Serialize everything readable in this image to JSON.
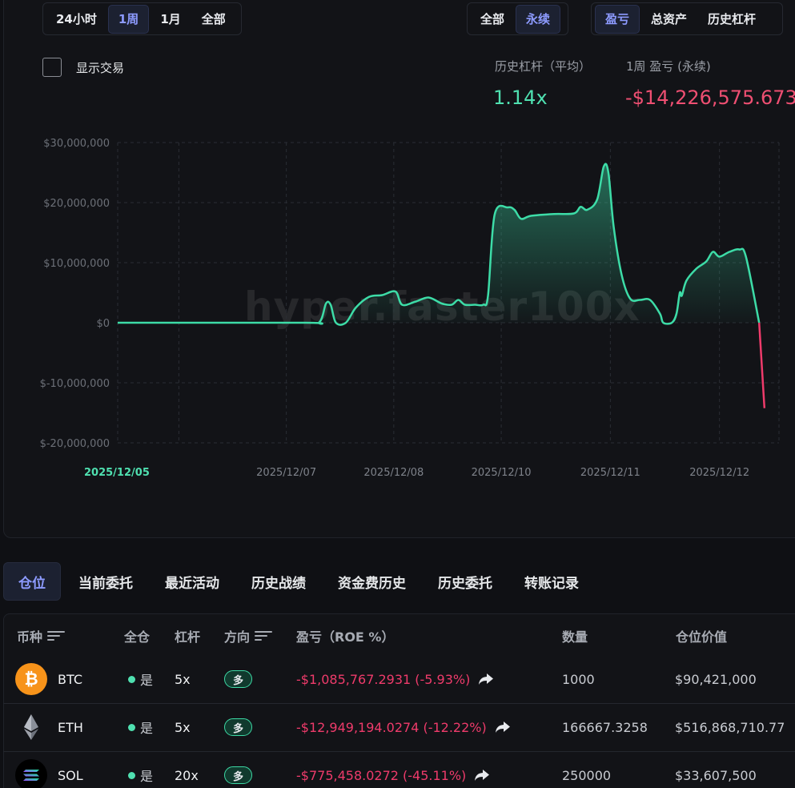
{
  "time_range": {
    "options": [
      "24小时",
      "1周",
      "1月",
      "全部"
    ],
    "selected": "1周"
  },
  "market_filter": {
    "options": [
      "全部",
      "永续"
    ],
    "selected": "永续"
  },
  "metric_tabs": {
    "options": [
      "盈亏",
      "总资产",
      "历史杠杆"
    ],
    "selected": "盈亏"
  },
  "show_trades_label": "显示交易",
  "stats": {
    "leverage_label": "历史杠杆（平均）",
    "leverage_value": "1.14x",
    "pnl_label": "1周 盈亏 (永续)",
    "pnl_value": "-$14,226,575.673"
  },
  "watermark": "hyper.faster100x",
  "colors": {
    "positive": "#3ddca7",
    "negative": "#ef3b6b",
    "accent": "#8d9bff",
    "background": "#0f1014"
  },
  "chart_data": {
    "type": "area",
    "y_ticks": [
      "$30,000,000",
      "$20,000,000",
      "$10,000,000",
      "$0",
      "$-10,000,000",
      "$-20,000,000"
    ],
    "ylim": [
      -20000000,
      30000000
    ],
    "x_ticks": [
      "2025/12/05",
      "2025/12/07",
      "2025/12/08",
      "2025/12/10",
      "2025/12/11",
      "2025/12/12"
    ],
    "x_tick_highlight": "2025/12/05",
    "grid": true,
    "series": [
      {
        "values": [
          [
            0,
            0
          ],
          [
            0.28,
            0
          ],
          [
            0.305,
            100000
          ],
          [
            0.315,
            3200000
          ],
          [
            0.322,
            3000000
          ],
          [
            0.33,
            0
          ],
          [
            0.345,
            0
          ],
          [
            0.36,
            2500000
          ],
          [
            0.38,
            4300000
          ],
          [
            0.4,
            4600000
          ],
          [
            0.42,
            5200000
          ],
          [
            0.43,
            3000000
          ],
          [
            0.45,
            3500000
          ],
          [
            0.47,
            4200000
          ],
          [
            0.49,
            3200000
          ],
          [
            0.505,
            3000000
          ],
          [
            0.515,
            3800000
          ],
          [
            0.525,
            3000000
          ],
          [
            0.54,
            3000000
          ],
          [
            0.553,
            3000000
          ],
          [
            0.56,
            4500000
          ],
          [
            0.57,
            18000000
          ],
          [
            0.59,
            19200000
          ],
          [
            0.6,
            18800000
          ],
          [
            0.61,
            17300000
          ],
          [
            0.625,
            17800000
          ],
          [
            0.66,
            18100000
          ],
          [
            0.69,
            18200000
          ],
          [
            0.7,
            19300000
          ],
          [
            0.71,
            18800000
          ],
          [
            0.725,
            20500000
          ],
          [
            0.735,
            26000000
          ],
          [
            0.742,
            25000000
          ],
          [
            0.75,
            16000000
          ],
          [
            0.762,
            8000000
          ],
          [
            0.775,
            4000000
          ],
          [
            0.79,
            3800000
          ],
          [
            0.805,
            3800000
          ],
          [
            0.82,
            1500000
          ],
          [
            0.825,
            0
          ],
          [
            0.838,
            0
          ],
          [
            0.845,
            1500000
          ],
          [
            0.85,
            5000000
          ],
          [
            0.853,
            4500000
          ],
          [
            0.86,
            7000000
          ],
          [
            0.875,
            9000000
          ],
          [
            0.89,
            10200000
          ],
          [
            0.9,
            11800000
          ],
          [
            0.91,
            11000000
          ],
          [
            0.925,
            11800000
          ],
          [
            0.94,
            12200000
          ],
          [
            0.95,
            11000000
          ],
          [
            0.97,
            0
          ]
        ]
      },
      {
        "values": [
          [
            0.97,
            0
          ],
          [
            0.978,
            -14226575
          ]
        ]
      }
    ]
  },
  "tabs": {
    "items": [
      "仓位",
      "当前委托",
      "最近活动",
      "历史战绩",
      "资金费历史",
      "历史委托",
      "转账记录"
    ],
    "selected": "仓位"
  },
  "table": {
    "headers": [
      "币种",
      "全仓",
      "杠杆",
      "方向",
      "盈亏（ROE %）",
      "数量",
      "仓位价值"
    ],
    "rows": [
      {
        "coin": "BTC",
        "icon": "bitcoin-icon",
        "cross_label": "是",
        "leverage": "5x",
        "side": "多",
        "pnl": "-$1,085,767.2931 (-5.93%)",
        "size": "1000",
        "value": "$90,421,000"
      },
      {
        "coin": "ETH",
        "icon": "ethereum-icon",
        "cross_label": "是",
        "leverage": "5x",
        "side": "多",
        "pnl": "-$12,949,194.0274 (-12.22%)",
        "size": "166667.3258",
        "value": "$516,868,710.77"
      },
      {
        "coin": "SOL",
        "icon": "solana-icon",
        "cross_label": "是",
        "leverage": "20x",
        "side": "多",
        "pnl": "-$775,458.0272 (-45.11%)",
        "size": "250000",
        "value": "$33,607,500"
      }
    ]
  }
}
